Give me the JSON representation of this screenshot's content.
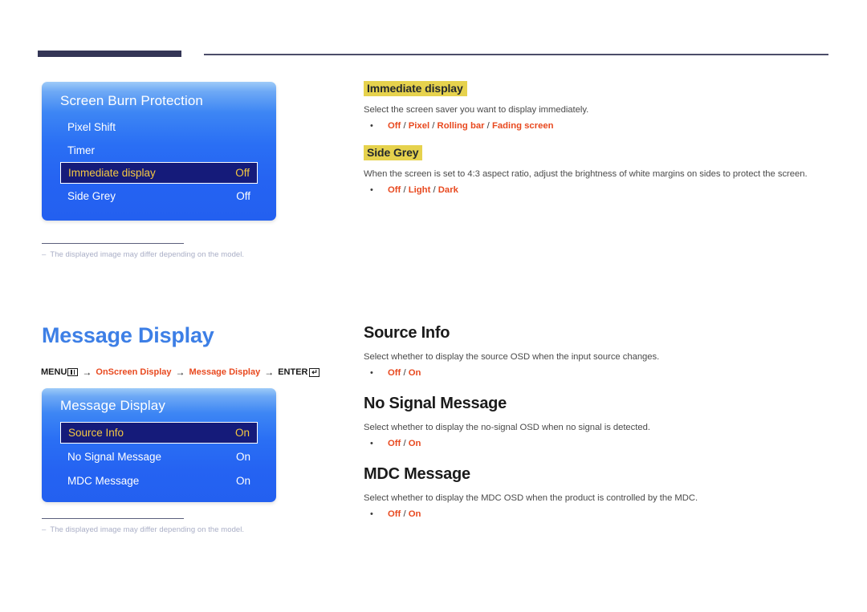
{
  "header": {
    "rule_label": "section-rule"
  },
  "sections": [
    {
      "osd": {
        "title": "Screen Burn Protection",
        "rows": [
          {
            "label": "Pixel Shift",
            "value": "",
            "selected": false
          },
          {
            "label": "Timer",
            "value": "",
            "selected": false
          },
          {
            "label": "Immediate display",
            "value": "Off",
            "selected": true
          },
          {
            "label": "Side Grey",
            "value": "Off",
            "selected": false
          }
        ]
      },
      "footnote": {
        "dash": "–",
        "text": "The displayed image may differ depending on the model."
      },
      "topics": [
        {
          "heading": "Immediate display",
          "heading_style": "highlight",
          "description": "Select the screen saver you want to display immediately.",
          "options": [
            "Off",
            "Pixel",
            "Rolling bar",
            "Fading screen"
          ]
        },
        {
          "heading": "Side Grey",
          "heading_style": "highlight",
          "description": "When the screen is set to 4:3 aspect ratio, adjust the brightness of white margins on sides to protect the screen.",
          "options": [
            "Off",
            "Light",
            "Dark"
          ]
        }
      ]
    },
    {
      "page_title": "Message Display",
      "breadcrumb": {
        "menu_label": "MENU",
        "menu_icon": "menu-bars-icon",
        "arrow": "→",
        "step1": "OnScreen Display",
        "step2": "Message Display",
        "enter_label": "ENTER",
        "enter_icon": "enter-return-icon",
        "enter_glyph": "↵"
      },
      "osd": {
        "title": "Message Display",
        "rows": [
          {
            "label": "Source Info",
            "value": "On",
            "selected": true
          },
          {
            "label": "No Signal Message",
            "value": "On",
            "selected": false
          },
          {
            "label": "MDC Message",
            "value": "On",
            "selected": false
          }
        ]
      },
      "footnote": {
        "dash": "–",
        "text": "The displayed image may differ depending on the model."
      },
      "topics": [
        {
          "heading": "Source Info",
          "heading_style": "plain",
          "description": "Select whether to display the source OSD when the input source changes.",
          "options": [
            "Off",
            "On"
          ]
        },
        {
          "heading": "No Signal Message",
          "heading_style": "plain",
          "description": "Select whether to display the no-signal OSD when no signal is detected.",
          "options": [
            "Off",
            "On"
          ]
        },
        {
          "heading": "MDC Message",
          "heading_style": "plain",
          "description": "Select whether to display the MDC OSD when the product is controlled by the MDC.",
          "options": [
            "Off",
            "On"
          ]
        }
      ]
    }
  ],
  "colors": {
    "accent_blue": "#3d7fe6",
    "osd_blue": "#2563f2",
    "osd_selected": "#151b7a",
    "osd_selected_text": "#f5c842",
    "highlight_yellow": "#e6d24d",
    "option_red": "#e8491f",
    "rule_navy": "#343656",
    "footnote_gray": "#a9aec6"
  }
}
